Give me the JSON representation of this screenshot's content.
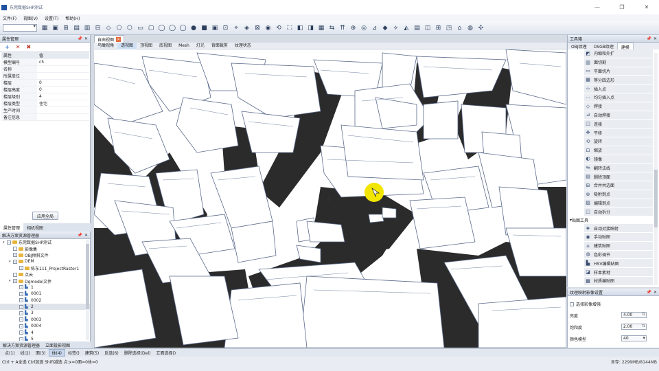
{
  "window": {
    "title": "东莞数据SHP测试",
    "controls": [
      "—",
      "❐",
      "✕"
    ]
  },
  "menu": [
    "文件(F)",
    "视图(V)",
    "设置(T)",
    "帮助(H)"
  ],
  "toolbar": {
    "combo_value": "",
    "tools": [
      "▦",
      "▣",
      "⊞",
      "▤",
      "▥",
      "⊟",
      "◇",
      "⬠",
      "⬡",
      "▭",
      "▢",
      "◯",
      "◯",
      "◯",
      "●",
      "■",
      "▣",
      "⊡",
      "⌖",
      "◈",
      "⊠",
      "◉",
      "⟲",
      "⬚",
      "◧",
      "◨",
      "▦",
      "⇆",
      "⇈",
      "⊕",
      "◎",
      "⊿",
      "◆",
      "⟡",
      "◭",
      "▤",
      "◫",
      "⊞",
      "◳",
      "⌂",
      "◍",
      "✣"
    ]
  },
  "properties": {
    "title": "属性管理",
    "header": [
      "属性",
      "值"
    ],
    "rows": [
      [
        "模型编号",
        "c5"
      ],
      [
        "名称",
        ""
      ],
      [
        "所属单位",
        ""
      ],
      [
        "楼层",
        "0"
      ],
      [
        "楼层高度",
        "0"
      ],
      [
        "楼层级别",
        "4"
      ],
      [
        "楼层类型",
        "住宅"
      ],
      [
        "生产时间",
        ""
      ],
      [
        "备注信息",
        ""
      ]
    ],
    "apply_label": "应用全局"
  },
  "left_tabs": [
    "属性管理",
    "相机视图"
  ],
  "resource": {
    "title": "解决方案资源管理器",
    "rows": [
      {
        "label": "东莞数据SHP测试",
        "indent": 0,
        "exp": "▾",
        "chk": true,
        "icon": "fold"
      },
      {
        "label": "影像集",
        "indent": 1,
        "exp": "",
        "chk": false,
        "icon": "fold"
      },
      {
        "label": "OBJ倾斜文件",
        "indent": 1,
        "exp": "",
        "chk": true,
        "icon": "fold"
      },
      {
        "label": "DEM",
        "indent": 1,
        "exp": "▾",
        "chk": true,
        "icon": "fold"
      },
      {
        "label": "栋东111_ProjectRaster1",
        "indent": 2,
        "exp": "",
        "chk": true,
        "icon": "fold"
      },
      {
        "label": "点云",
        "indent": 1,
        "exp": "",
        "chk": false,
        "icon": "fold"
      },
      {
        "label": "Dgmodel文件",
        "indent": 1,
        "exp": "▾",
        "chk": true,
        "icon": "fold"
      },
      {
        "label": "1",
        "indent": 2,
        "exp": "",
        "chk": true,
        "icon": "lay"
      },
      {
        "label": "0001",
        "indent": 2,
        "exp": "",
        "chk": true,
        "icon": "lay"
      },
      {
        "label": "0002",
        "indent": 2,
        "exp": "",
        "chk": true,
        "icon": "lay"
      },
      {
        "label": "2",
        "indent": 2,
        "exp": "",
        "chk": true,
        "icon": "lay",
        "sel": true
      },
      {
        "label": "3",
        "indent": 2,
        "exp": "",
        "chk": true,
        "icon": "lay"
      },
      {
        "label": "0003",
        "indent": 2,
        "exp": "",
        "chk": true,
        "icon": "lay"
      },
      {
        "label": "0004",
        "indent": 2,
        "exp": "",
        "chk": true,
        "icon": "lay"
      },
      {
        "label": "4",
        "indent": 2,
        "exp": "",
        "chk": true,
        "icon": "lay"
      },
      {
        "label": "5",
        "indent": 2,
        "exp": "",
        "chk": true,
        "icon": "lay"
      }
    ]
  },
  "bottom_left_tabs": [
    "解决方案资源管理器",
    "立面投影视图"
  ],
  "doc": {
    "tab_label": "自由视图"
  },
  "view_tabs": [
    "鸟瞰视角",
    "透视图",
    "顶视图",
    "底视图",
    "Mesh",
    "灯光",
    "背面裁剪",
    "纹理状态"
  ],
  "view_tabs_active": 1,
  "toolbox": {
    "title": "工具箱",
    "tabs": [
      "OBJ纹理",
      "OSGB纹理",
      "建模"
    ],
    "active_tab": 2,
    "items": [
      {
        "icon": "◩",
        "label": "内缩和外扩"
      },
      {
        "icon": "▥",
        "label": "面切割"
      },
      {
        "icon": "▭",
        "label": "平面切片"
      },
      {
        "icon": "▦",
        "label": "等分四边形"
      },
      {
        "icon": "⊹",
        "label": "插入点"
      },
      {
        "icon": "⋯",
        "label": "均匀插入点"
      },
      {
        "icon": "◇",
        "label": "焊接"
      },
      {
        "icon": "⊿",
        "label": "自动焊接"
      },
      {
        "icon": "◳",
        "label": "连接"
      },
      {
        "icon": "✥",
        "label": "平移"
      },
      {
        "icon": "⟲",
        "label": "旋转"
      },
      {
        "icon": "⊡",
        "label": "缩放"
      },
      {
        "icon": "◐",
        "label": "镜像"
      },
      {
        "icon": "⇋",
        "label": "翻转法线"
      },
      {
        "icon": "▤",
        "label": "删除顶面"
      },
      {
        "icon": "⊞",
        "label": "合并共边面"
      },
      {
        "icon": "⊕",
        "label": "吸附到点"
      },
      {
        "icon": "▨",
        "label": "编辑到点"
      },
      {
        "icon": "◫",
        "label": "自动拆分"
      }
    ],
    "section2": "贴图工具",
    "items2": [
      {
        "icon": "◈",
        "label": "自动对接映射"
      },
      {
        "icon": "◉",
        "label": "手动贴图"
      },
      {
        "icon": "⌂",
        "label": "建筑贴图"
      },
      {
        "icon": "◍",
        "label": "色彩调节"
      },
      {
        "icon": "▙",
        "label": "HSV编辑贴图"
      },
      {
        "icon": "◪",
        "label": "样本素材"
      },
      {
        "icon": "▩",
        "label": "材质编贴图"
      }
    ]
  },
  "texture": {
    "title": "纹理映射影像设置",
    "checkbox_label": "选择影像增强",
    "brightness_label": "亮度",
    "brightness_value": "4.00",
    "saturation_label": "饱和度",
    "saturation_value": "2.00",
    "model_label": "颜色模型",
    "model_value": "40"
  },
  "select_bar": [
    "点(1)",
    "线(2)",
    "面(3)",
    "体(4)",
    "标签()",
    "建筑(5)",
    "反选(6)",
    "删除选择(Del)",
    "立面选择()"
  ],
  "select_bar_active": 3,
  "status": {
    "hint": "Ctrl + A全选 Ctrl加选 Shift减选 点:x=0面=0体=0",
    "memory": "显存: 2299MB/8144MB"
  }
}
